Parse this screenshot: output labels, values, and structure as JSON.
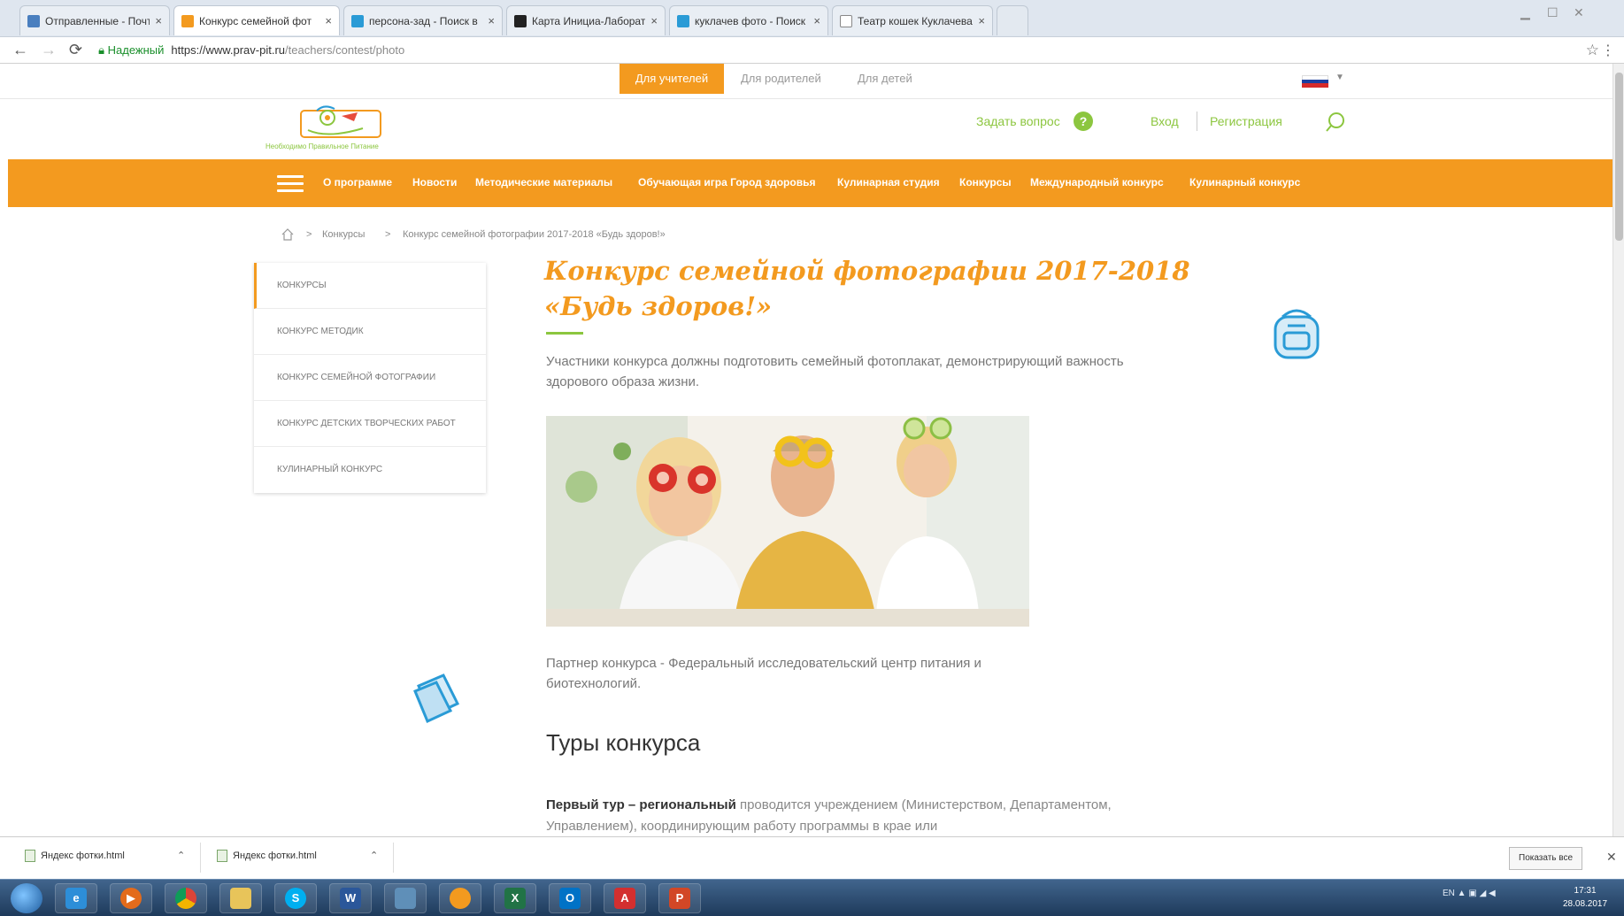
{
  "browser": {
    "tabs": [
      {
        "label": "Отправленные - Почта",
        "icon_color": "#4a7fbf"
      },
      {
        "label": "Конкурс семейной фот",
        "icon_color": "#f39a1f"
      },
      {
        "label": "персона-зад - Поиск в",
        "icon_color": "#2a9bd6"
      },
      {
        "label": "Карта Инициа-Лаборат",
        "icon_color": "#222222"
      },
      {
        "label": "куклачев фото - Поиск",
        "icon_color": "#2a9bd6"
      },
      {
        "label": "Театр кошек Куклачева",
        "icon_color": "#888888"
      }
    ],
    "secure_label": "Надежный",
    "url_host": "https://www.prav-pit.ru",
    "url_path": "/teachers/contest/photo"
  },
  "audience": {
    "teachers": "Для учителей",
    "parents": "Для родителей",
    "kids": "Для детей"
  },
  "header": {
    "logo_caption": "Необходимо Правильное Питание",
    "ask_question": "Задать вопрос",
    "ask_icon": "?",
    "login": "Вход",
    "register": "Регистрация"
  },
  "nav": {
    "items": [
      "О программе",
      "Новости",
      "Методические материалы",
      "Обучающая игра Город здоровья",
      "Кулинарная студия",
      "Конкурсы",
      "Международный конкурс",
      "Кулинарный конкурс"
    ]
  },
  "breadcrumb": {
    "sep": ">",
    "items": [
      "Конкурсы",
      "Конкурс семейной фотографии 2017-2018 «Будь здоров!»"
    ]
  },
  "sidebar": {
    "items": [
      "Конкурсы",
      "Конкурс методик",
      "Конкурс семейной фотографии",
      "Конкурс детских творческих работ",
      "Кулинарный конкурс"
    ]
  },
  "content": {
    "title": "Конкурс семейной фотографии 2017-2018 «Будь здоров!»",
    "intro": "Участники конкурса должны подготовить семейный фотоплакат, демонстрирующий важность здорового образа жизни.",
    "partner": "Партнер конкурса - Федеральный исследовательский центр питания и биотехнологий.",
    "tours_heading": "Туры конкурса",
    "tour1_bold": "Первый тур – региональный",
    "tour1_text": " проводится учреждением (Министерством, Департаментом, Управлением), координирующим работу программы в крае или"
  },
  "downloads": {
    "items": [
      "Яндекс фотки.html",
      "Яндекс фотки.html"
    ],
    "show_all": "Показать все"
  },
  "taskbar": {
    "tray_lang": "EN",
    "time": "17:31",
    "date": "28.08.2017"
  },
  "colors": {
    "brand_orange": "#f39a1f",
    "brand_green": "#8cc63f"
  }
}
